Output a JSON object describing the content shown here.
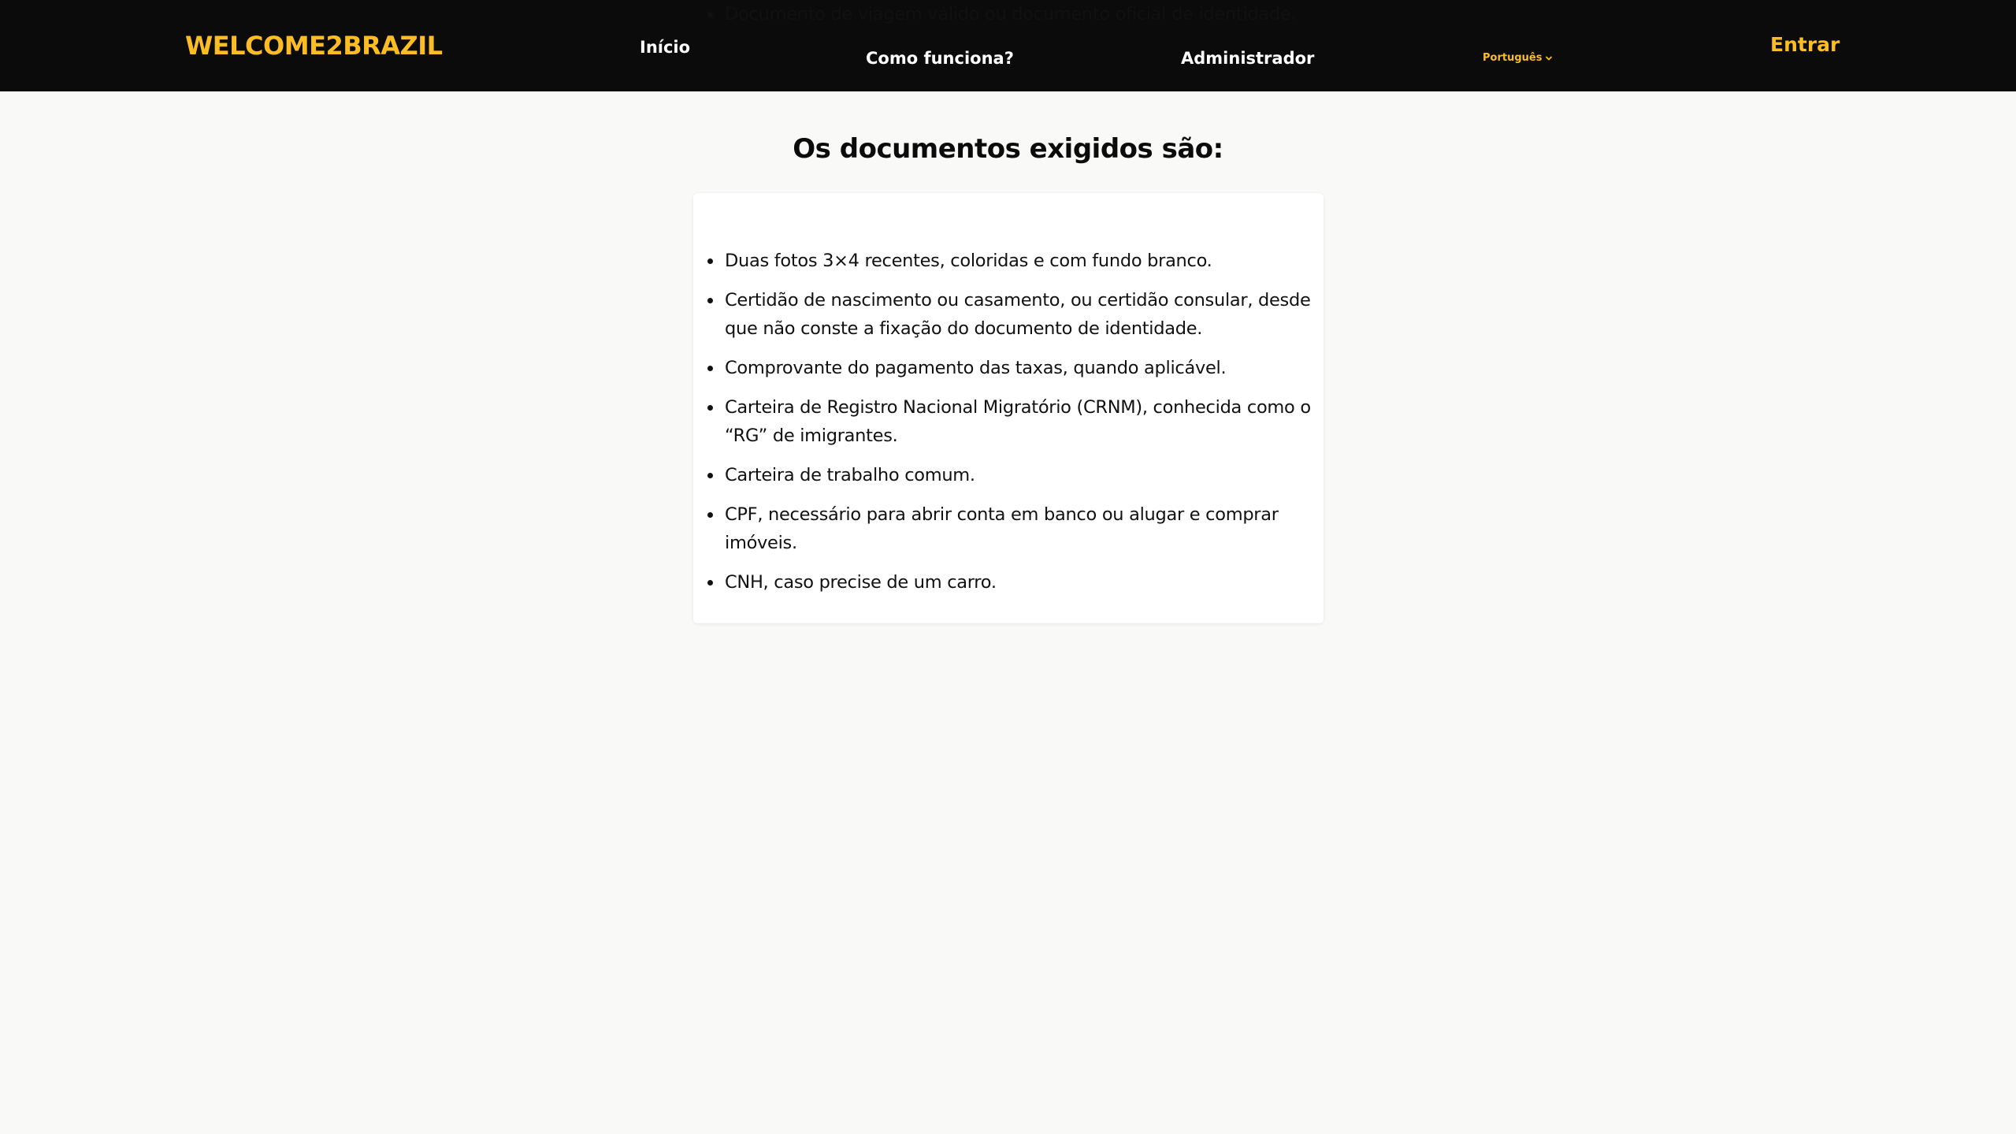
{
  "header": {
    "brand": "WELCOME2BRAZIL",
    "nav": {
      "inicio": "Início",
      "como_funciona": "Como funciona?",
      "administrador": "Administrador"
    },
    "language": "Português",
    "language_icon": "chevron-down-icon",
    "login": "Entrar"
  },
  "main": {
    "title": "Os documentos exigidos são:",
    "documents": [
      "Documento de viagem válido ou documento oficial de identidade.",
      "Duas fotos 3×4 recentes, coloridas e com fundo branco.",
      "Certidão de nascimento ou casamento, ou certidão consular, desde que não conste a fixação do documento de identidade.",
      "Comprovante do pagamento das taxas, quando aplicável.",
      "Carteira de Registro Nacional Migratório (CRNM), conhecida como o “RG” de imigrantes.",
      "Carteira de trabalho comum.",
      "CPF, necessário para abrir conta em banco ou alugar e comprar imóveis.",
      "CNH, caso precise de um carro."
    ]
  },
  "colors": {
    "accent": "#fbbd23",
    "navbar": "#0b0b0b",
    "background": "#f9f9f8",
    "card": "#ffffff"
  }
}
